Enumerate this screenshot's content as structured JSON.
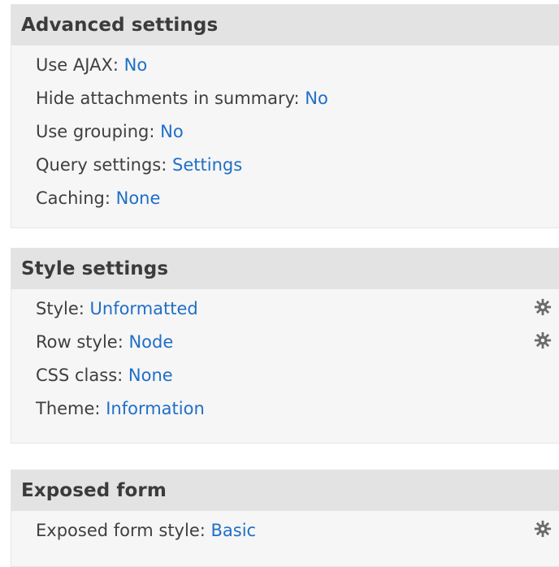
{
  "sections": [
    {
      "title": "Advanced settings",
      "rows": [
        {
          "label": "Use AJAX:",
          "value": "No"
        },
        {
          "label": "Hide attachments in summary:",
          "value": "No"
        },
        {
          "label": "Use grouping:",
          "value": "No"
        },
        {
          "label": "Query settings:",
          "value": "Settings"
        },
        {
          "label": "Caching:",
          "value": "None"
        }
      ]
    },
    {
      "title": "Style settings",
      "rows": [
        {
          "label": "Style:",
          "value": "Unformatted",
          "icon": "gear-icon"
        },
        {
          "label": "Row style:",
          "value": "Node",
          "icon": "gear-icon"
        },
        {
          "label": "CSS class:",
          "value": "None"
        },
        {
          "label": "Theme:",
          "value": "Information"
        }
      ]
    },
    {
      "title": "Exposed form",
      "rows": [
        {
          "label": "Exposed form style:",
          "value": "Basic",
          "icon": "gear-icon"
        }
      ]
    }
  ],
  "colors": {
    "link": "#1f6fc7",
    "header_bg": "#e3e3e3",
    "panel_bg": "#f6f6f6"
  }
}
